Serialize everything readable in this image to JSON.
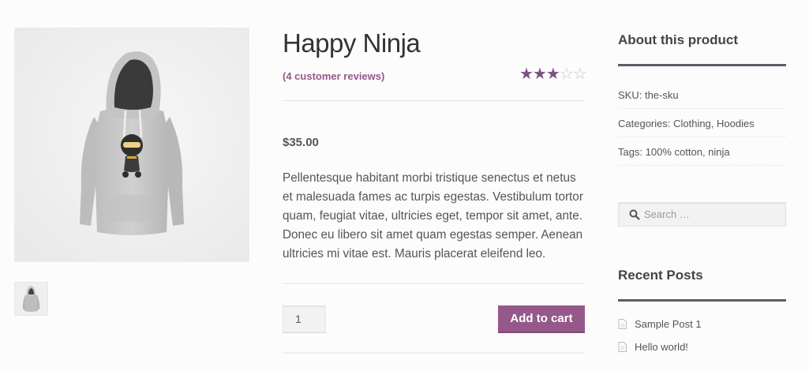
{
  "product": {
    "title": "Happy Ninja",
    "reviews_link": "(4 customer reviews)",
    "rating": {
      "value": 3,
      "max": 5
    },
    "price": "$35.00",
    "description": "Pellentesque habitant morbi tristique senectus et netus et malesuada fames ac turpis egestas. Vestibulum tortor quam, feugiat vitae, ultricies eget, tempor sit amet, ante. Donec eu libero sit amet quam egestas semper. Aenean ultricies mi vitae est. Mauris placerat eleifend leo.",
    "quantity": "1",
    "add_to_cart_label": "Add to cart"
  },
  "sidebar": {
    "about": {
      "title": "About this product",
      "sku": "SKU: the-sku",
      "categories": "Categories: Clothing, Hoodies",
      "tags": "Tags: 100% cotton, ninja"
    },
    "search": {
      "placeholder": "Search …"
    },
    "recent_posts": {
      "title": "Recent Posts",
      "items": [
        {
          "label": "Sample Post 1"
        },
        {
          "label": "Hello world!"
        }
      ]
    }
  },
  "colors": {
    "accent": "#96588a",
    "star_filled": "#7b5281",
    "widget_rule": "#5a5e68"
  },
  "icons": {
    "search": "search-icon",
    "post": "document-icon",
    "star": "star-icon"
  }
}
